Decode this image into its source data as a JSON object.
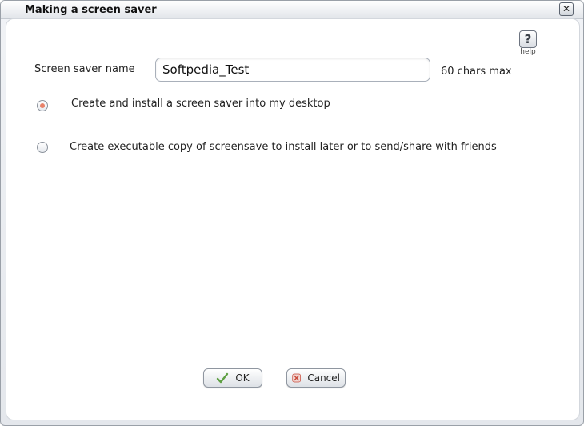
{
  "window": {
    "title": "Making a screen saver",
    "close_label": "✕"
  },
  "help": {
    "glyph": "?",
    "label": "help"
  },
  "form": {
    "name_label": "Screen saver name",
    "name_value": "Softpedia_Test",
    "max_label": "60 chars max"
  },
  "options": [
    {
      "label": "Create and install a screen saver into my desktop",
      "checked": true
    },
    {
      "label": "Create executable copy of screensave to install later or to send/share with friends",
      "checked": false
    }
  ],
  "buttons": {
    "ok_label": "OK",
    "cancel_label": "Cancel"
  },
  "icons": {
    "ok": "checkmark-icon",
    "cancel": "cancel-x-icon",
    "help": "help-question-icon",
    "close": "close-icon"
  },
  "colors": {
    "radio_selected": "#e8826a",
    "ok_icon": "#5fa044",
    "cancel_icon": "#c84a3a"
  }
}
